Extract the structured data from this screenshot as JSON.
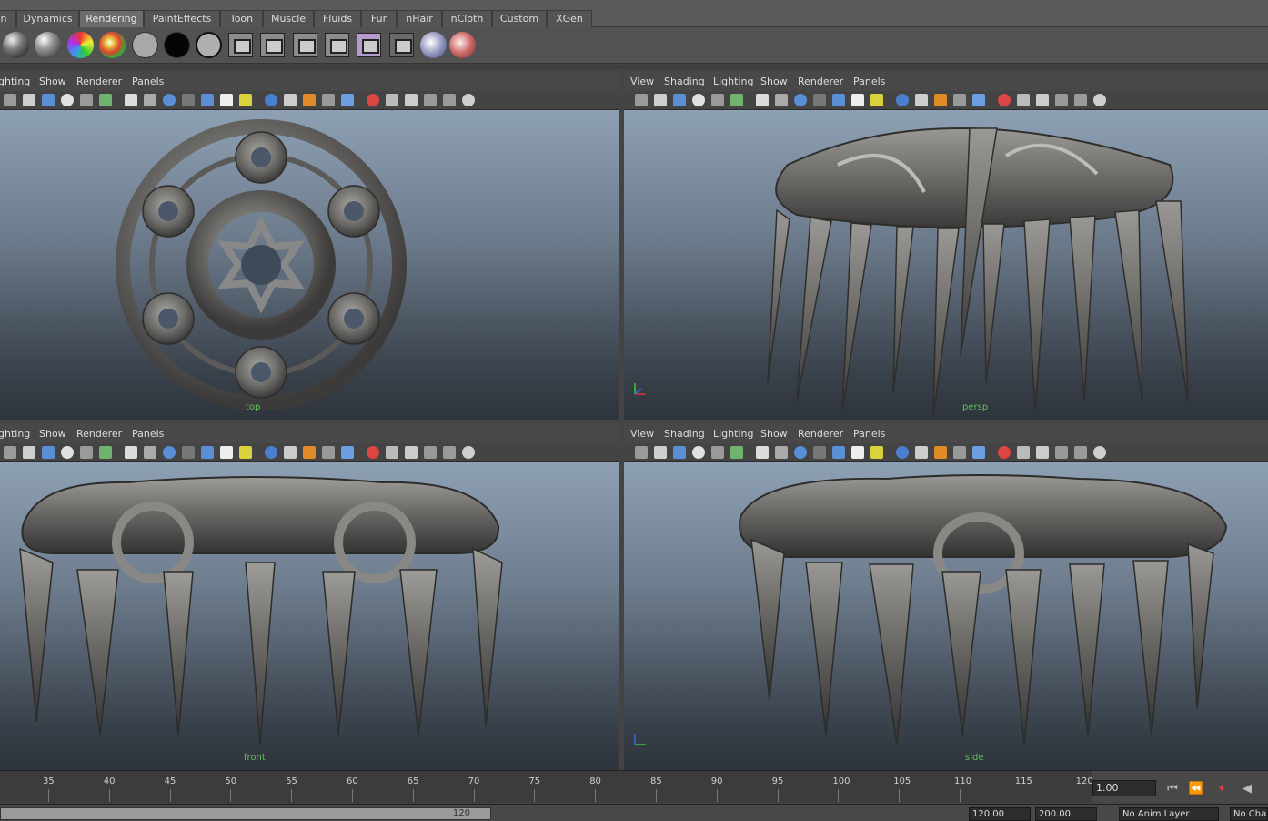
{
  "shelf_tabs": [
    {
      "label": "n",
      "active": false
    },
    {
      "label": "Dynamics",
      "active": false
    },
    {
      "label": "Rendering",
      "active": true
    },
    {
      "label": "PaintEffects",
      "active": false
    },
    {
      "label": "Toon",
      "active": false
    },
    {
      "label": "Muscle",
      "active": false
    },
    {
      "label": "Fluids",
      "active": false
    },
    {
      "label": "Fur",
      "active": false
    },
    {
      "label": "nHair",
      "active": false
    },
    {
      "label": "nCloth",
      "active": false
    },
    {
      "label": "Custom",
      "active": false
    },
    {
      "label": "XGen",
      "active": false
    }
  ],
  "panel_menus_left": [
    "ghting",
    "Show",
    "Renderer",
    "Panels"
  ],
  "panel_menus_right": [
    "View",
    "Shading",
    "Lighting",
    "Show",
    "Renderer",
    "Panels"
  ],
  "viewports": {
    "top": {
      "label": "top"
    },
    "persp": {
      "label": "persp"
    },
    "front": {
      "label": "front"
    },
    "side": {
      "label": "side"
    }
  },
  "timeline": {
    "ticks": [
      "35",
      "40",
      "45",
      "50",
      "55",
      "60",
      "65",
      "70",
      "75",
      "80",
      "85",
      "90",
      "95",
      "100",
      "105",
      "110",
      "115",
      "120"
    ],
    "current_frame": "1.00"
  },
  "range": {
    "end_on_bar": "120",
    "end_time": "120.00",
    "max_time": "200.00",
    "anim_layer": "No Anim Layer",
    "character": "No Cha"
  },
  "colors": {
    "accent_active_tab": "#6c6c6c",
    "view_top": "#8ea0b4",
    "view_bottom": "#2e343b",
    "object": "#7a7978",
    "label_green": "#5fbf5f"
  }
}
